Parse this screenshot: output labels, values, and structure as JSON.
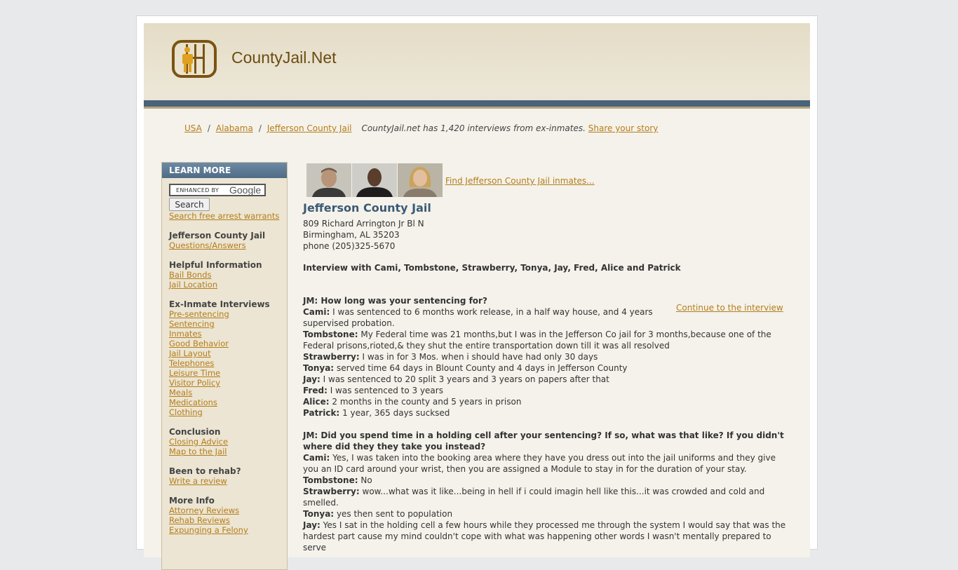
{
  "site": {
    "name": "CountyJail.Net"
  },
  "breadcrumb": {
    "items": [
      "USA",
      "Alabama",
      "Jefferson County Jail"
    ],
    "note": "CountyJail.net has 1,420 interviews from ex-inmates.",
    "share_link": "Share your story"
  },
  "sidebar": {
    "header": "LEARN MORE",
    "search": {
      "enhanced_label": "ENHANCED BY",
      "brand": "Google",
      "button": "Search"
    },
    "arrest_link": "Search free arrest warrants",
    "sections": [
      {
        "title": "Jefferson County Jail",
        "links": [
          "Questions/Answers"
        ]
      },
      {
        "title": "Helpful Information",
        "links": [
          "Bail Bonds",
          "Jail Location"
        ]
      },
      {
        "title": "Ex-Inmate Interviews",
        "links": [
          "Pre-sentencing",
          "Sentencing",
          "Inmates",
          "Good Behavior",
          "Jail Layout",
          "Telephones",
          "Leisure Time",
          "Visitor Policy",
          "Meals",
          "Medications",
          "Clothing"
        ]
      },
      {
        "title": "Conclusion",
        "links": [
          "Closing Advice",
          "Map to the Jail"
        ]
      },
      {
        "title": "Been to rehab?",
        "links": [
          "Write a review"
        ]
      },
      {
        "title": "More Info",
        "links": [
          "Attorney Reviews",
          "Rehab Reviews",
          "Expunging a Felony"
        ]
      }
    ]
  },
  "main": {
    "find_link": "Find Jefferson County Jail inmates...",
    "title": "Jefferson County Jail",
    "address": [
      "809 Richard Arrington Jr Bl N",
      "Birmingham, AL 35203",
      "phone (205)325-5670"
    ],
    "interview_title": "Interview with Cami, Tombstone, Strawberry, Tonya, Jay, Fred, Alice and Patrick",
    "continue_link": "Continue to the interview",
    "qa": [
      {
        "question": "JM: How long was your sentencing for?",
        "answers": [
          {
            "name": "Cami:",
            "text": "I was sentenced to 6 months work release, in a half way house, and 4 years supervised probation."
          },
          {
            "name": "Tombstone:",
            "text": "My Federal time was 21 months,but I was in the Jefferson Co jail for 3 months,because one of the Federal prisons,rioted,& they shut the entire transportation down till it was all resolved"
          },
          {
            "name": "Strawberry:",
            "text": "I was in for 3 Mos. when i should have had only 30 days"
          },
          {
            "name": "Tonya:",
            "text": "served time 64 days in Blount County and 4 days in Jefferson County"
          },
          {
            "name": "Jay:",
            "text": "I was sentenced to 20 split 3 years and 3 years on papers after that"
          },
          {
            "name": "Fred:",
            "text": "I was sentenced to 3 years"
          },
          {
            "name": "Alice:",
            "text": "2 months in the county and 5 years in prison"
          },
          {
            "name": "Patrick:",
            "text": "1 year, 365 days sucksed"
          }
        ]
      },
      {
        "question": "JM: Did you spend time in a holding cell after your sentencing? If so, what was that like? If you didn't where did they they take you instead?",
        "answers": [
          {
            "name": "Cami:",
            "text": "Yes, I was taken into the booking area where they have you dress out into the jail uniforms and they give you an ID card around your wrist, then you are assigned a Module to stay in for the duration of your stay."
          },
          {
            "name": "Tombstone:",
            "text": "No"
          },
          {
            "name": "Strawberry:",
            "text": "wow...what was it like...being in hell if i could imagin hell like this...it was crowded and cold and smelled."
          },
          {
            "name": "Tonya:",
            "text": "yes then sent to population"
          },
          {
            "name": "Jay:",
            "text": "Yes I sat in the holding cell a few hours while they processed me through the system I would say that was the hardest part cause my mind couldn't cope with what was happening other words I wasn't mentally prepared to serve"
          }
        ]
      }
    ]
  },
  "colors": {
    "accent_link": "#b47d1a",
    "header_bar": "#4a6378",
    "title": "#3b5a75"
  }
}
